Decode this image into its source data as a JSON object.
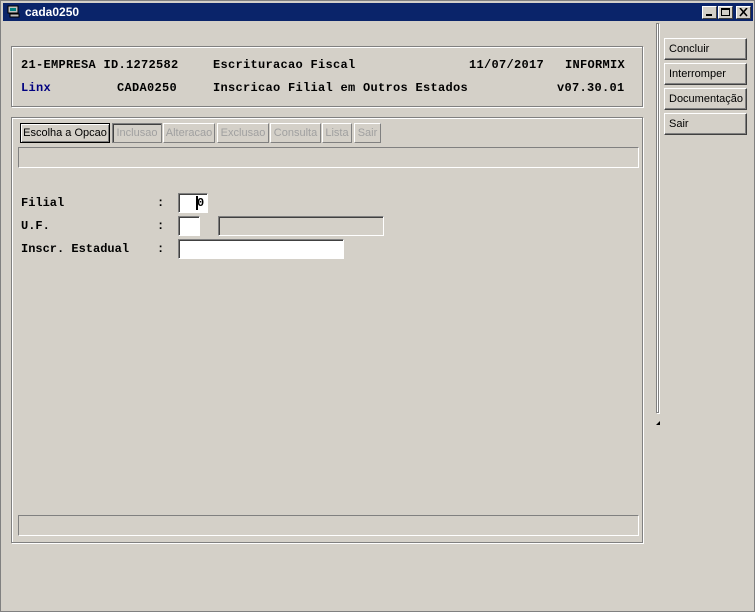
{
  "window": {
    "title": "cada0250",
    "controls": {
      "minimize": "minimize-icon",
      "maximize": "maximize-icon",
      "close": "close-icon"
    }
  },
  "header": {
    "line1": {
      "company": "21-EMPRESA ID.1272582",
      "module": "Escrituracao Fiscal",
      "date": "11/07/2017",
      "db": "INFORMIX"
    },
    "line2": {
      "brand": "Linx",
      "program": "CADA0250",
      "screen": "Inscricao Filial em Outros Estados",
      "version": "v07.30.01"
    },
    "brand_color": "#000080"
  },
  "options": {
    "choose": "Escolha a Opcao",
    "inclusao": "Inclusao",
    "alteracao": "Alteracao",
    "exclusao": "Exclusao",
    "consulta": "Consulta",
    "lista": "Lista",
    "sair": "Sair"
  },
  "form": {
    "filial": {
      "label": "Filial",
      "colon": ":",
      "value": "0"
    },
    "uf": {
      "label": "U.F.",
      "colon": ":",
      "value": "",
      "description": ""
    },
    "inscr": {
      "label": "Inscr. Estadual",
      "colon": ":",
      "value": ""
    }
  },
  "side_buttons": {
    "concluir": "Concluir",
    "interromper": "Interromper",
    "documentacao": "Documentação",
    "sair": "Sair"
  }
}
